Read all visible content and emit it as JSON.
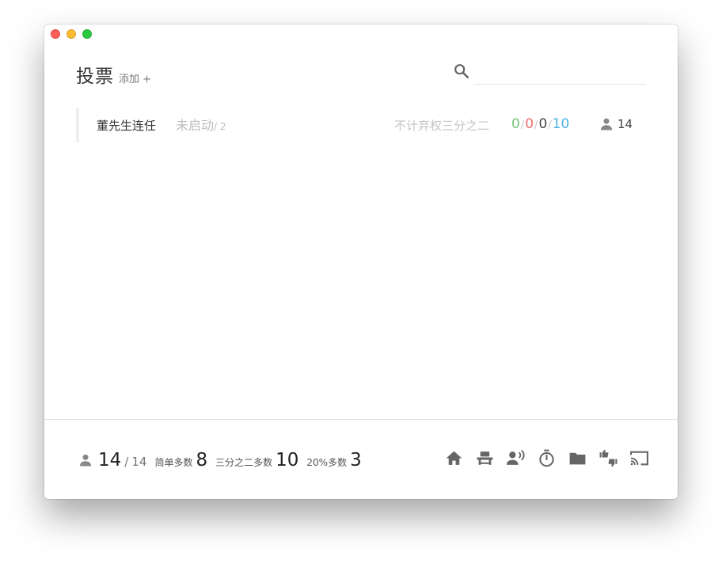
{
  "window": {
    "controls": [
      "close",
      "minimize",
      "maximize"
    ]
  },
  "header": {
    "title": "投票",
    "add_label": "添加 +"
  },
  "search": {
    "icon": "search-icon",
    "value": "",
    "placeholder": ""
  },
  "votes": [
    {
      "title": "董先生连任",
      "status": "未启动",
      "status_sub": "/ 2",
      "rule": "不计弃权三分之二",
      "tally": {
        "yes": "0",
        "no": "0",
        "abstain": "0",
        "total": "10",
        "sep": "/"
      },
      "people": "14",
      "colors": {
        "yes": "#77c378",
        "no": "#ef6f6c",
        "abstain": "#444444",
        "total": "#4fb0e3"
      }
    }
  ],
  "footer": {
    "present": "14",
    "present_sep": "/",
    "present_total": "14",
    "simple_label": "简单多数",
    "simple_value": "8",
    "twothirds_label": "三分之二多数",
    "twothirds_value": "10",
    "twenty_label": "20%多数",
    "twenty_value": "3",
    "icons": [
      "home-icon",
      "seat-icon",
      "speaker-icon",
      "timer-icon",
      "folder-icon",
      "vote-thumbs-icon",
      "cast-icon"
    ]
  }
}
